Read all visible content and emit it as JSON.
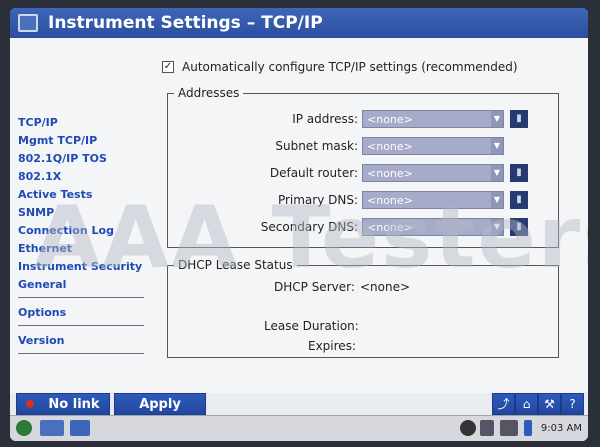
{
  "title": "Instrument Settings – TCP/IP",
  "auto_config": {
    "checked": true,
    "check_glyph": "✓",
    "label": "Automatically configure TCP/IP settings (recommended)"
  },
  "sidebar": {
    "items": [
      {
        "label": "TCP/IP"
      },
      {
        "label": "Mgmt TCP/IP"
      },
      {
        "label": "802.1Q/IP TOS"
      },
      {
        "label": "802.1X"
      },
      {
        "label": "Active Tests"
      },
      {
        "label": "SNMP"
      },
      {
        "label": "Connection Log"
      },
      {
        "label": "Ethernet"
      },
      {
        "label": "Instrument Security"
      },
      {
        "label": "General"
      }
    ],
    "options": "Options",
    "version": "Version"
  },
  "addresses": {
    "legend": "Addresses",
    "fields": [
      {
        "label": "IP address:",
        "value": "<none>"
      },
      {
        "label": "Subnet mask:",
        "value": "<none>"
      },
      {
        "label": "Default router:",
        "value": "<none>"
      },
      {
        "label": "Primary DNS:",
        "value": "<none>"
      },
      {
        "label": "Secondary DNS:",
        "value": "<none>"
      }
    ]
  },
  "dhcp": {
    "legend": "DHCP Lease Status",
    "server_label": "DHCP Server:",
    "server_value": "<none>",
    "lease_label": "Lease Duration:",
    "expires_label": "Expires:"
  },
  "bottom": {
    "link_status": "No link",
    "apply": "Apply"
  },
  "taskbar": {
    "time": "9:03 AM"
  },
  "watermark": "AAA Testers",
  "colors": {
    "accent": "#2b4f9e",
    "link_led": "#d8321e",
    "nav_text": "#1f49b4"
  }
}
